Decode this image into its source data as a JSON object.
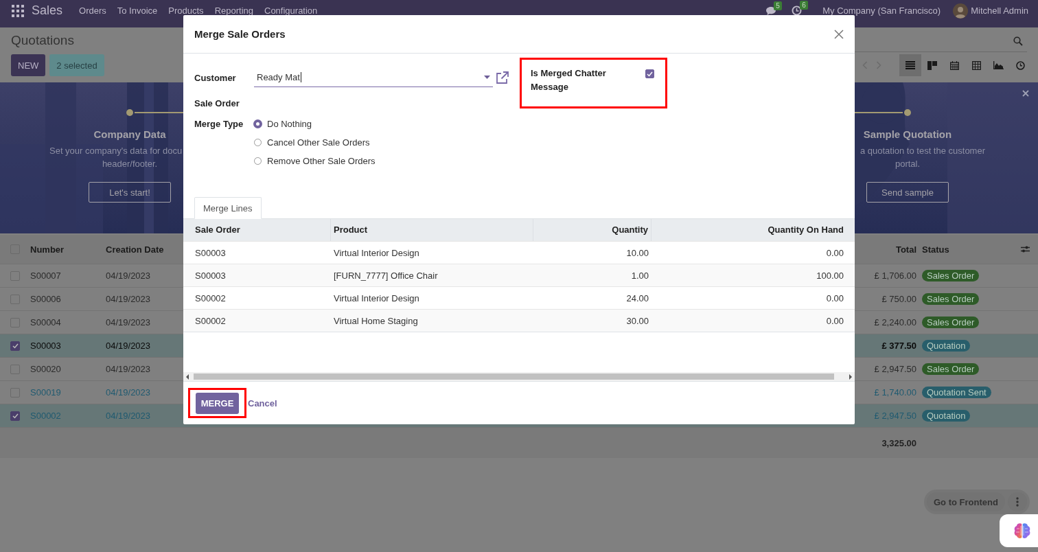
{
  "navbar": {
    "app": "Sales",
    "menu": [
      "Orders",
      "To Invoice",
      "Products",
      "Reporting",
      "Configuration"
    ],
    "messages_count": "5",
    "activities_count": "6",
    "company": "My Company (San Francisco)",
    "user": "Mitchell Admin"
  },
  "control_panel": {
    "title": "Quotations",
    "buttons": [
      {
        "label": "NEW",
        "kind": "primary"
      },
      {
        "label": "2 selected",
        "kind": "selection"
      }
    ],
    "views": [
      {
        "kind": "list",
        "selected": true
      },
      {
        "kind": "kanban",
        "selected": false
      },
      {
        "kind": "calendar",
        "selected": false
      },
      {
        "kind": "pivot",
        "selected": false
      },
      {
        "kind": "graph",
        "selected": false
      },
      {
        "kind": "activity",
        "selected": false
      }
    ]
  },
  "banner": {
    "steps": [
      {
        "title": "Company Data",
        "lines": [
          "Set your company's data for docu",
          "header/footer."
        ],
        "button": "Let's start!"
      },
      {
        "title": "Sample Quotation",
        "lines": [
          "a quotation to test the customer",
          "portal."
        ],
        "button": "Send sample"
      }
    ]
  },
  "list": {
    "all_selected": false,
    "columns": [
      "Number",
      "Creation Date",
      "Total",
      "Status"
    ],
    "rows": [
      {
        "selected": false,
        "kind": "default",
        "number": "S00007",
        "date": "04/19/2023",
        "total": "£ 1,706.00",
        "status": "Sales Order",
        "color": "#2e5b28"
      },
      {
        "selected": false,
        "kind": "default",
        "number": "S00006",
        "date": "04/19/2023",
        "total": "£ 750.00",
        "status": "Sales Order",
        "color": "#2e5b28"
      },
      {
        "selected": false,
        "kind": "default",
        "number": "S00004",
        "date": "04/19/2023",
        "total": "£ 2,240.00",
        "status": "Sales Order",
        "color": "#2e5b28"
      },
      {
        "selected": true,
        "kind": "current",
        "number": "S00003",
        "date": "04/19/2023",
        "total": "£ 377.50",
        "status": "Quotation",
        "color": "#285e6b"
      },
      {
        "selected": false,
        "kind": "default",
        "number": "S00020",
        "date": "04/19/2023",
        "total": "£ 2,947.50",
        "status": "Sales Order",
        "color": "#2e5b28"
      },
      {
        "selected": false,
        "kind": "sent",
        "number": "S00019",
        "date": "04/19/2023",
        "total": "£ 1,740.00",
        "status": "Quotation Sent",
        "color": "#285e6b"
      },
      {
        "selected": true,
        "kind": "sent",
        "number": "S00002",
        "date": "04/19/2023",
        "total": "£ 2,947.50",
        "status": "Quotation",
        "color": "#285e6b"
      }
    ],
    "sum": "3,325.00"
  },
  "dialog": {
    "title": "Merge Sale Orders",
    "customer_label": "Customer",
    "customer_value": "Ready Mat",
    "sale_order_label": "Sale Order",
    "merge_type_label": "Merge Type",
    "options": [
      {
        "label": "Do Nothing",
        "selected": true
      },
      {
        "label": "Cancel Other Sale Orders",
        "selected": false
      },
      {
        "label": "Remove Other Sale Orders",
        "selected": false
      }
    ],
    "chatter": {
      "label": "Is Merged Chatter Message",
      "checked": true
    },
    "tabs": [
      {
        "label": "Merge Lines",
        "selected": true
      }
    ],
    "table": {
      "columns": [
        "Sale Order",
        "Product",
        "Quantity",
        "Quantity On Hand"
      ],
      "rows": [
        [
          "S00003",
          "Virtual Interior Design",
          "10.00",
          "0.00"
        ],
        [
          "S00003",
          "[FURN_7777] Office Chair",
          "1.00",
          "100.00"
        ],
        [
          "S00002",
          "Virtual Interior Design",
          "24.00",
          "0.00"
        ],
        [
          "S00002",
          "Virtual Home Staging",
          "30.00",
          "0.00"
        ]
      ]
    },
    "buttons": [
      {
        "label": "MERGE",
        "kind": "primary"
      },
      {
        "label": "Cancel",
        "kind": "link"
      }
    ]
  },
  "frontend_button": "Go to Frontend"
}
